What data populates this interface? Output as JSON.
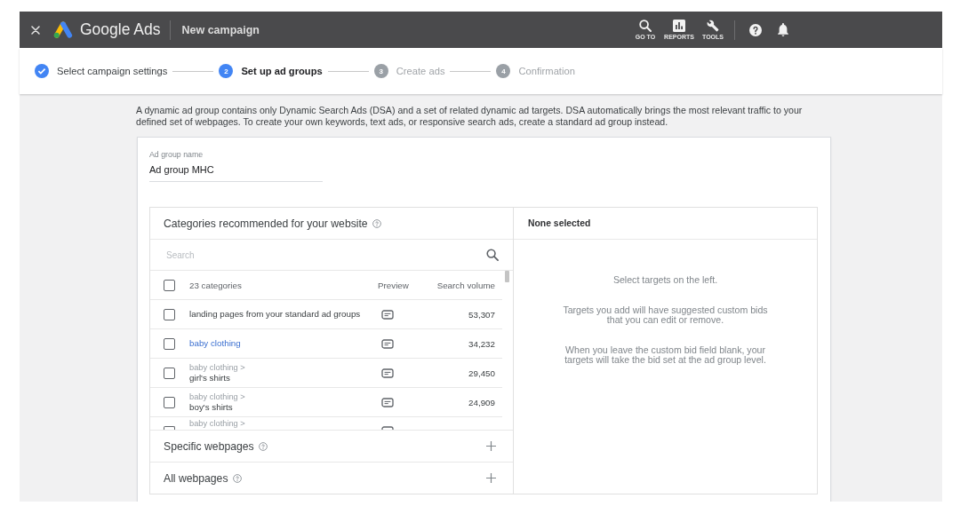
{
  "header": {
    "product": "Google Ads",
    "page_title": "New campaign",
    "tools": [
      {
        "kind": "search",
        "label": "GO TO"
      },
      {
        "kind": "reports",
        "label": "REPORTS"
      },
      {
        "kind": "tools",
        "label": "TOOLS"
      }
    ]
  },
  "steps": [
    {
      "label": "Select campaign settings",
      "completed": true,
      "active": false
    },
    {
      "number": "2",
      "label": "Set up ad groups",
      "completed": false,
      "active": true
    },
    {
      "number": "3",
      "label": "Create ads",
      "completed": false,
      "active": false
    },
    {
      "number": "4",
      "label": "Confirmation",
      "completed": false,
      "active": false
    }
  ],
  "intro": "A dynamic ad group contains only Dynamic Search Ads (DSA) and a set of related dynamic ad targets. DSA automatically brings the most relevant traffic to your defined set of webpages. To create your own keywords, text ads, or responsive search ads, create a standard ad group instead.",
  "ad_group": {
    "label": "Ad group name",
    "value": "Ad group MHC"
  },
  "categories": {
    "title": "Categories recommended for your website",
    "search_placeholder": "Search",
    "columns": [
      "23 categories",
      "Preview",
      "Search volume"
    ],
    "select_all_checked": false,
    "rows": [
      {
        "kind": "plain",
        "name": "landing pages from your standard ad groups",
        "volume": "53,307",
        "checked": false
      },
      {
        "kind": "link",
        "name": "baby clothing",
        "volume": "34,232",
        "checked": false
      },
      {
        "kind": "child",
        "parent": "baby clothing >",
        "name": "girl's shirts",
        "volume": "29,450",
        "checked": false
      },
      {
        "kind": "child",
        "parent": "baby clothing >",
        "name": "boy's shirts",
        "volume": "24,909",
        "checked": false
      },
      {
        "kind": "partial",
        "parent": "baby clothing >",
        "checked": false
      }
    ]
  },
  "sections": [
    {
      "title": "Specific webpages"
    },
    {
      "title": "All webpages"
    }
  ],
  "selection": {
    "title": "None selected",
    "hints": [
      "Select targets on the left.",
      "Targets you add will have suggested custom bids that you can edit or remove.",
      "When you leave the custom bid field blank, your targets will take the bid set at the ad group level."
    ]
  }
}
